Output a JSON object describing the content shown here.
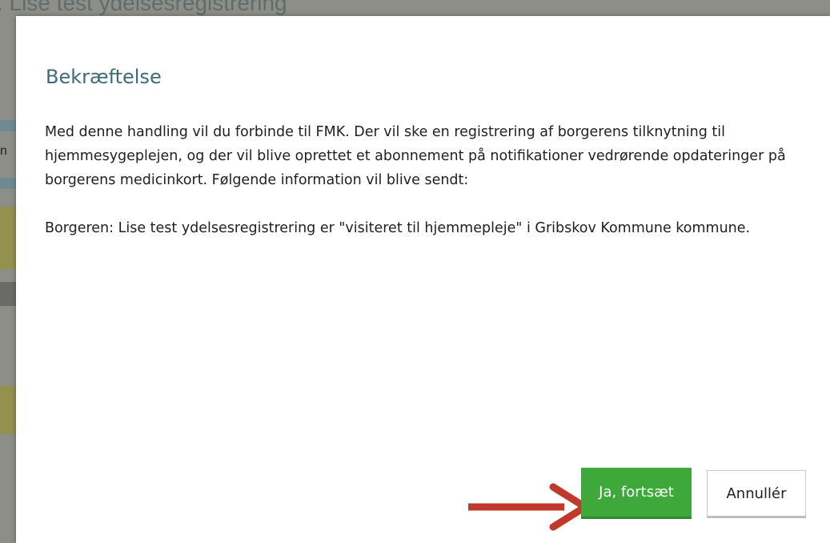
{
  "background": {
    "page_title_partial": ". Lise test ydelsesregistrering",
    "edge_letter": "n"
  },
  "dialog": {
    "title": "Bekræftelse",
    "paragraph1": "Med denne handling vil du forbinde til FMK. Der vil ske en registrering af borgerens tilknytning til hjemmesygeplejen, og der vil blive oprettet et abonnement på notifikationer vedrørende opdateringer på borgerens medicinkort. Følgende information vil blive sendt:",
    "paragraph2": "Borgeren: Lise test ydelsesregistrering er \"visiteret til hjemmepleje\" i Gribskov Kommune kommune.",
    "confirm_label": "Ja, fortsæt",
    "cancel_label": "Annullér"
  },
  "annotation": {
    "arrow_icon": "red-arrow-right-icon",
    "arrow_color": "#c0392b"
  },
  "colors": {
    "title": "#3d6b78",
    "confirm_bg": "#3ea93a",
    "backdrop": "#8e8e88"
  }
}
